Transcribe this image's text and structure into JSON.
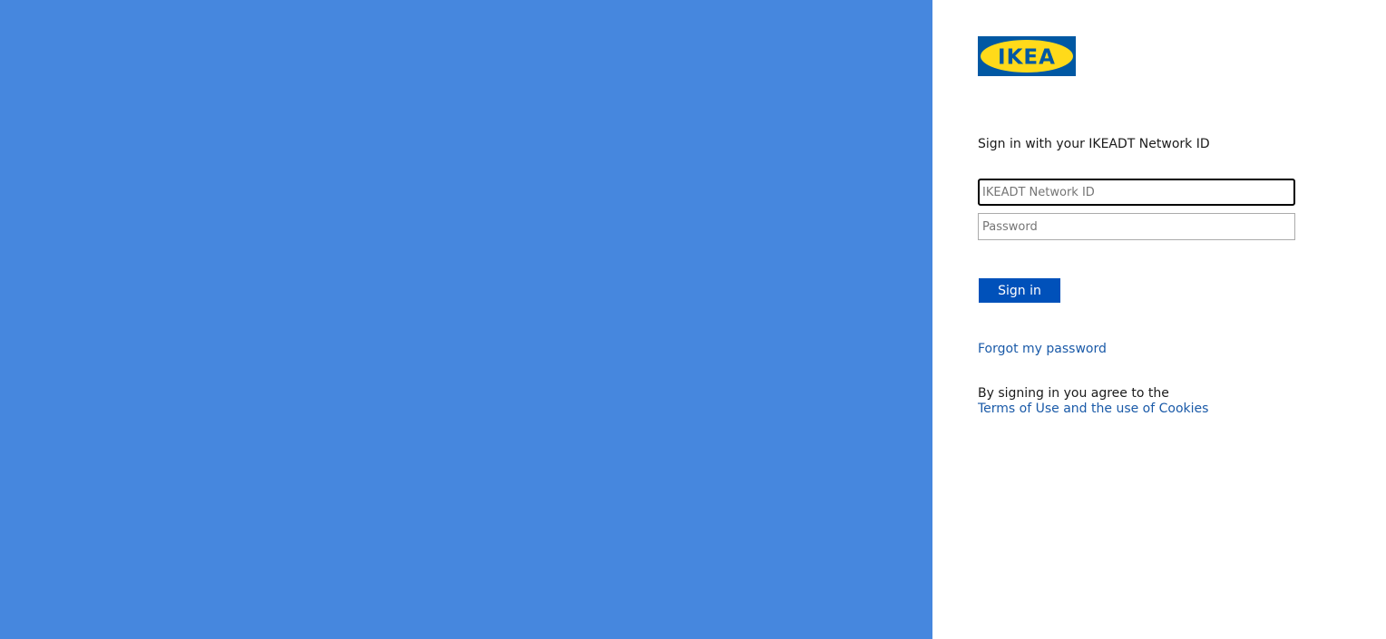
{
  "colors": {
    "illustration_bg": "#4687de",
    "accent": "#0051ba",
    "link": "#1a5aa8"
  },
  "logo": {
    "text": "IKEA",
    "icon": "ikea-logo"
  },
  "form": {
    "intro": "Sign in with your IKEADT Network ID",
    "username_placeholder": "IKEADT Network ID",
    "password_placeholder": "Password",
    "submit_label": "Sign in"
  },
  "links": {
    "forgot_password": "Forgot my password",
    "agreement_text": "By signing in you agree to the",
    "terms": "Terms of Use and the use of Cookies"
  }
}
